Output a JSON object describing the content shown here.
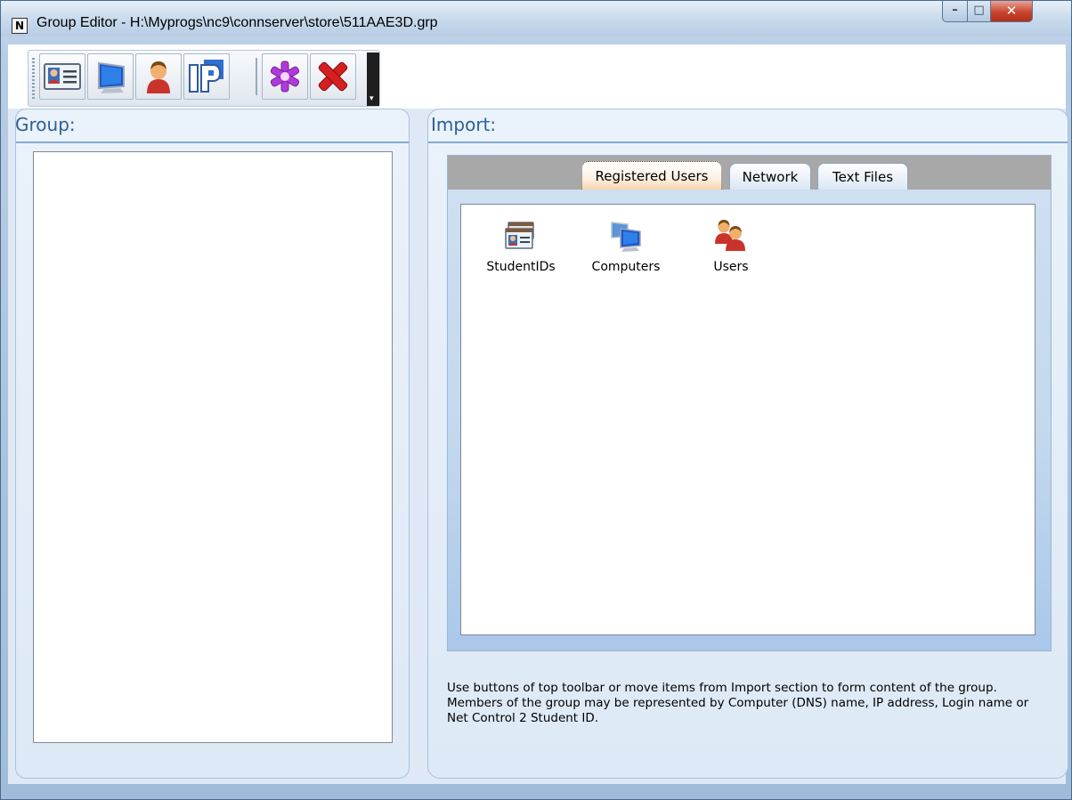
{
  "window": {
    "title": "Group Editor - H:\\Myprogs\\nc9\\connserver\\store\\511AAE3D.grp",
    "app_icon_letter": "N"
  },
  "toolbar": {
    "buttons": [
      {
        "icon": "student-id-card-icon"
      },
      {
        "icon": "computer-monitor-icon"
      },
      {
        "icon": "user-icon"
      },
      {
        "icon": "ip-address-icon"
      },
      {
        "icon": "asterisk-star-icon"
      },
      {
        "icon": "delete-x-icon"
      }
    ]
  },
  "group_panel": {
    "header": "Group:"
  },
  "import_panel": {
    "header": "Import:",
    "tabs": [
      {
        "label": "Registered Users",
        "active": true
      },
      {
        "label": "Network",
        "active": false
      },
      {
        "label": "Text Files",
        "active": false
      }
    ],
    "items": [
      {
        "label": "StudentIDs",
        "icon": "student-ids-icon"
      },
      {
        "label": "Computers",
        "icon": "computers-icon"
      },
      {
        "label": "Users",
        "icon": "users-icon"
      }
    ],
    "help_text": "Use buttons of top toolbar or move items from Import section to form content of the group. Members of the group may be represented by Computer (DNS) name, IP address, Login name or Net Control 2 Student ID."
  },
  "colors": {
    "accent_header": "#2e5f96",
    "close_button": "#c8452f",
    "active_tab": "#f6d4ab"
  }
}
